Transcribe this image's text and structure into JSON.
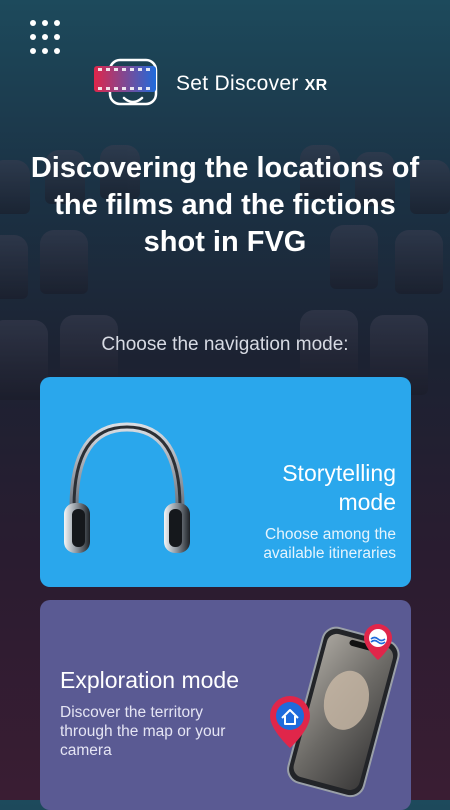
{
  "app": {
    "brand_name": "Set Discover",
    "brand_suffix": "XR"
  },
  "menu": {
    "icon": "grid-dots-icon"
  },
  "headline": "Discovering the locations of the films and the fictions shot in FVG",
  "subtitle": "Choose the navigation mode:",
  "modes": [
    {
      "title": "Storytelling mode",
      "description": "Choose among the available itineraries",
      "icon": "headphones-icon",
      "color": "#2aa7ec"
    },
    {
      "title": "Exploration mode",
      "description": "Discover the territory through the map or your camera",
      "icon": "phone-map-pins-icon",
      "color": "#5a5a93"
    }
  ],
  "colors": {
    "logo_red": "#e0264a",
    "logo_blue": "#1f6bdc",
    "pin_red": "#e0264a"
  }
}
